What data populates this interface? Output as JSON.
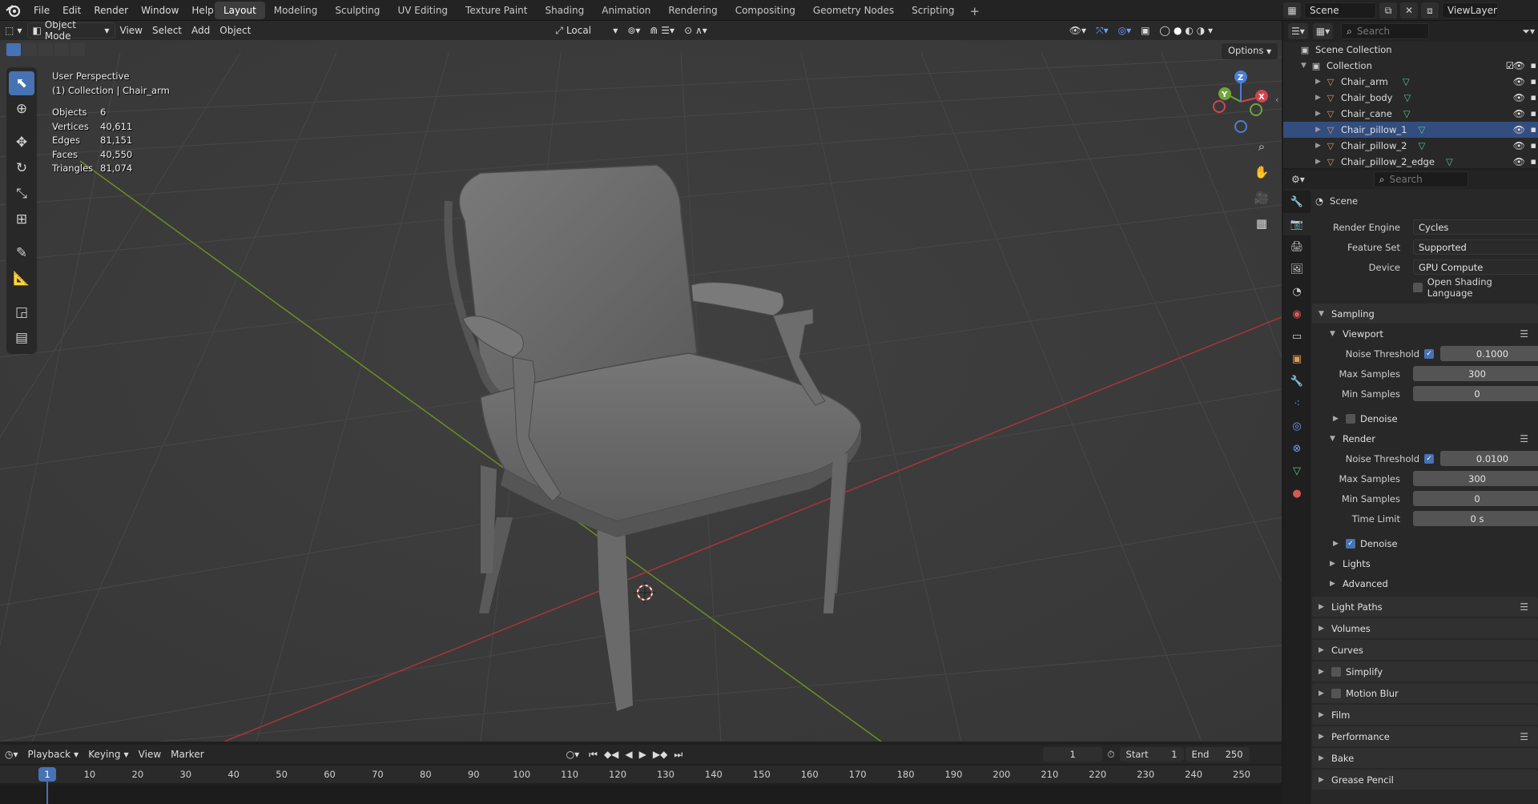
{
  "topbar": {
    "menus": [
      "File",
      "Edit",
      "Render",
      "Window",
      "Help"
    ],
    "workspaces": [
      "Layout",
      "Modeling",
      "Sculpting",
      "UV Editing",
      "Texture Paint",
      "Shading",
      "Animation",
      "Rendering",
      "Compositing",
      "Geometry Nodes",
      "Scripting"
    ],
    "scene": "Scene",
    "view_layer": "ViewLayer"
  },
  "viewport": {
    "mode": "Object Mode",
    "menus": [
      "View",
      "Select",
      "Add",
      "Object"
    ],
    "transform_orientation": "Local",
    "options": "Options",
    "view_name": "User Perspective",
    "context": "(1) Collection | Chair_arm",
    "stats": [
      {
        "k": "Objects",
        "v": "6"
      },
      {
        "k": "Vertices",
        "v": "40,611"
      },
      {
        "k": "Edges",
        "v": "81,151"
      },
      {
        "k": "Faces",
        "v": "40,550"
      },
      {
        "k": "Triangles",
        "v": "81,074"
      }
    ],
    "gizmo": {
      "z": "Z",
      "y": "Y",
      "x": "X"
    }
  },
  "timeline": {
    "menus": [
      "Playback",
      "Keying",
      "View",
      "Marker"
    ],
    "current_frame": "1",
    "start_label": "Start",
    "start": "1",
    "end_label": "End",
    "end": "250",
    "ticks": [
      "1",
      "10",
      "20",
      "30",
      "40",
      "50",
      "60",
      "70",
      "80",
      "90",
      "100",
      "110",
      "120",
      "130",
      "140",
      "150",
      "160",
      "170",
      "180",
      "190",
      "200",
      "210",
      "220",
      "230",
      "240",
      "250"
    ]
  },
  "outliner": {
    "search_placeholder": "Search",
    "scene_collection": "Scene Collection",
    "collection": "Collection",
    "items": [
      "Chair_arm",
      "Chair_body",
      "Chair_cane",
      "Chair_pillow_1",
      "Chair_pillow_2",
      "Chair_pillow_2_edge"
    ],
    "selected": "Chair_pillow_1"
  },
  "properties": {
    "search_placeholder": "Search",
    "context": "Scene",
    "render_engine_label": "Render Engine",
    "render_engine": "Cycles",
    "feature_set_label": "Feature Set",
    "feature_set": "Supported",
    "device_label": "Device",
    "device": "GPU Compute",
    "osl": "Open Shading Language",
    "sampling": "Sampling",
    "viewport": "Viewport",
    "noise_threshold_label": "Noise Threshold",
    "vp_noise": "0.1000",
    "max_samples_label": "Max Samples",
    "vp_max": "300",
    "min_samples_label": "Min Samples",
    "vp_min": "0",
    "denoise": "Denoise",
    "render": "Render",
    "r_noise": "0.0100",
    "r_max": "300",
    "r_min": "0",
    "time_limit_label": "Time Limit",
    "r_time": "0 s",
    "lights": "Lights",
    "advanced": "Advanced",
    "sections": [
      "Light Paths",
      "Volumes",
      "Curves",
      "Simplify",
      "Motion Blur",
      "Film",
      "Performance",
      "Bake",
      "Grease Pencil"
    ]
  }
}
